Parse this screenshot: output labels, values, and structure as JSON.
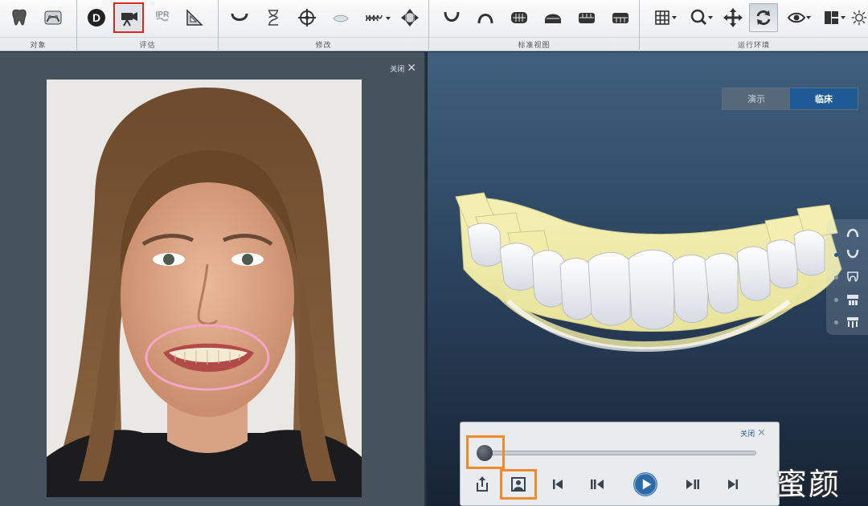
{
  "toolbar": {
    "groups": [
      {
        "label": "对象"
      },
      {
        "label": "评估"
      },
      {
        "label": "修改"
      },
      {
        "label": "标准视图"
      },
      {
        "label": "运行环境"
      }
    ],
    "buttons": {
      "tooth": "tooth-icon",
      "arch_model": "arch-model-icon",
      "d_tool": "D",
      "photo_camera": "camera-icon",
      "ipr": "IPR",
      "ruler": "ruler-triangle-icon",
      "arch_form": "arch-form-icon",
      "hourglass": "hourglass-icon",
      "target": "crosshair-icon",
      "overlay": "overlay-icon",
      "jaw_menu": "jaw-dropdown-icon",
      "move_arrows": "move-arrows-icon",
      "view_upper": "upper-arch-icon",
      "view_lower": "lower-arch-icon",
      "view_front": "front-view-icon",
      "view_back": "back-view-icon",
      "view_left": "left-view-icon",
      "view_right": "right-view-icon",
      "grid": "grid-icon",
      "zoom": "zoom-icon",
      "pan": "pan-icon",
      "rotate": "rotate-icon",
      "eye": "eye-icon",
      "layout": "layout-icon",
      "light": "light-icon"
    }
  },
  "left_panel": {
    "close_label": "关闭"
  },
  "view3d": {
    "mode_demo": "演示",
    "mode_clinical": "临床",
    "active_mode": "临床"
  },
  "playback": {
    "close_label": "关闭",
    "progress": 0.0
  },
  "watermark": "蜜颜",
  "colors": {
    "accent_blue": "#1e5a96",
    "highlight_red": "#e0231b",
    "highlight_orange": "#f08a2b",
    "mouth_ring_pink": "#f4a6c9"
  }
}
